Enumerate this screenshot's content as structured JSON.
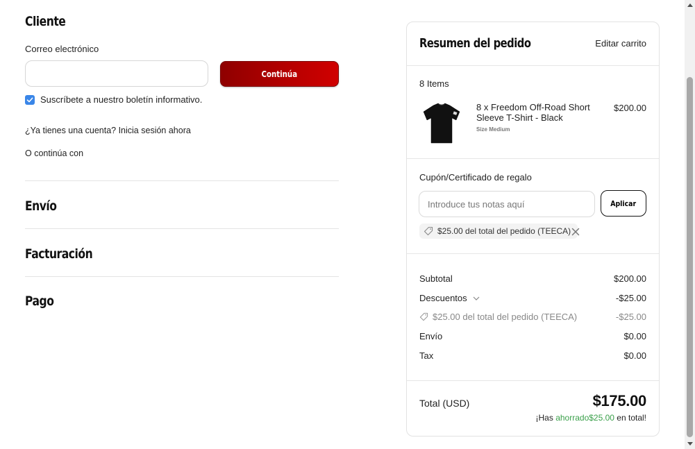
{
  "customer": {
    "title": "Cliente",
    "email_label": "Correo electrónico",
    "email_value": "",
    "continue_label": "Continúa",
    "newsletter_label": "Suscríbete a nuestro boletín informativo.",
    "newsletter_checked": true,
    "account_prompt": "¿Ya tienes una cuenta? Inicia sesión ahora",
    "continue_with": "O continúa con"
  },
  "sections": {
    "shipping": "Envío",
    "billing": "Facturación",
    "payment": "Pago"
  },
  "summary": {
    "title": "Resumen del pedido",
    "edit_cart": "Editar carrito",
    "items_count": "8 Items",
    "product": {
      "name": "8 x Freedom Off-Road Short Sleeve T-Shirt - Black",
      "size": "Size Medium",
      "price": "$200.00",
      "image_icon": "black-tshirt-image"
    },
    "coupon": {
      "label": "Cupón/Certificado de regalo",
      "placeholder": "Introduce tus notas aquí",
      "apply_label": "Aplicar",
      "applied": "$25.00 del total del pedido (TEECA)"
    },
    "totals": {
      "subtotal_label": "Subtotal",
      "subtotal_value": "$200.00",
      "discounts_label": "Descuentos",
      "discounts_value": "-$25.00",
      "discount_detail_label": "$25.00 del total del pedido (TEECA)",
      "discount_detail_value": "-$25.00",
      "shipping_label": "Envío",
      "shipping_value": "$0.00",
      "tax_label": "Tax",
      "tax_value": "$0.00",
      "total_label": "Total (USD)",
      "total_value": "$175.00",
      "savings_prefix": "¡Has",
      "savings_saved": "ahorrado",
      "savings_amount": "$25.00",
      "savings_suffix": "en total!"
    }
  },
  "colors": {
    "primary_button": "#b40000",
    "checkbox": "#3a86e8",
    "savings_green": "#3aa04a"
  }
}
